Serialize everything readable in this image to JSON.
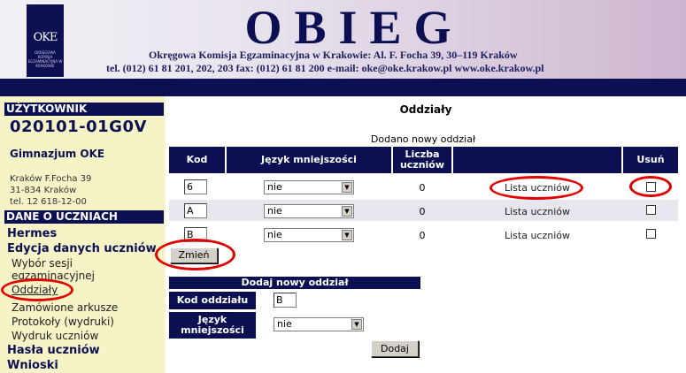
{
  "header": {
    "logo_text": "OKE",
    "logo_small": "Okręgowa Komisja Egzaminacyjna w Krakowie",
    "title": "OBIEG",
    "address_line1": "Okręgowa Komisja Egzaminacyjna w Krakowie:  Al. F. Focha 39, 30–119 Kraków",
    "address_line2": "tel. (012) 61 81 201, 202, 203  fax: (012) 61 81 200  e-mail: oke@oke.krakow.pl   www.oke.krakow.pl"
  },
  "sidebar": {
    "user_header": "UŻYTKOWNIK",
    "user_code": "020101-01G0V",
    "school_name": "Gimnazjum OKE",
    "school_addr1": "Kraków F.Focha 39",
    "school_addr2": "31-834 Kraków",
    "school_phone": "tel. 12 618-12-00",
    "section_header": "DANE O UCZNIACH",
    "hermes": "Hermes",
    "edycja": "Edycja danych uczniów",
    "wybor": "Wybór sesji",
    "wybor2": "egzaminacyjnej",
    "oddzialy": "Oddziały",
    "zamowione": "Zamówione arkusze",
    "protokoly": "Protokoły (wydruki)",
    "wydruk": "Wydruk uczniów",
    "hasla": "Hasła uczniów",
    "wnioski": "Wnioski"
  },
  "main": {
    "page_title": "Oddziały",
    "message": "Dodano nowy oddział",
    "columns": {
      "kod": "Kod",
      "jezyk": "Język mniejszości",
      "liczba1": "Liczba",
      "liczba2": "uczniów",
      "usun": "Usuń"
    },
    "rows": [
      {
        "kod": "6",
        "jezyk": "nie",
        "liczba": "0",
        "lista": "Lista uczniów"
      },
      {
        "kod": "A",
        "jezyk": "nie",
        "liczba": "0",
        "lista": "Lista uczniów"
      },
      {
        "kod": "B",
        "jezyk": "nie",
        "liczba": "0",
        "lista": "Lista uczniów"
      }
    ],
    "change_button": "Zmień",
    "add_section_header": "Dodaj nowy oddział",
    "kod_label": "Kod oddziału",
    "kod_value": "B",
    "jezyk_label1": "Język",
    "jezyk_label2": "mniejszości",
    "jezyk_value": "nie",
    "add_button": "Dodaj"
  },
  "colors": {
    "navy": "#0c1053",
    "sidebar_bg": "#f6f3c7",
    "highlight": "#e00000"
  }
}
